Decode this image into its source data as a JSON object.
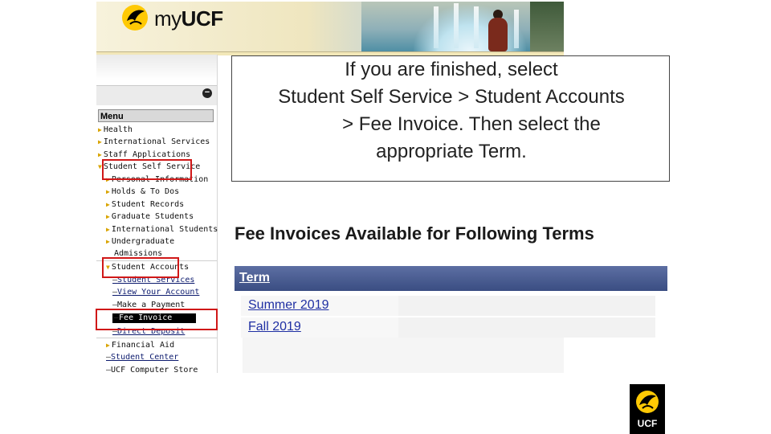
{
  "banner": {
    "logo_prefix": "my",
    "logo_name": "UCF"
  },
  "sidebar": {
    "collapse_symbol": "−",
    "menu_header": "Menu",
    "items": [
      {
        "label": "Health",
        "type": "folder"
      },
      {
        "label": "International Services",
        "type": "folder"
      },
      {
        "label": "Staff Applications",
        "type": "folder"
      },
      {
        "label": "Student Self Service",
        "type": "folder-open"
      },
      {
        "label": "Personal Information",
        "type": "subfolder"
      },
      {
        "label": "Holds & To Dos",
        "type": "subfolder"
      },
      {
        "label": "Student Records",
        "type": "subfolder"
      },
      {
        "label": "Graduate Students",
        "type": "subfolder"
      },
      {
        "label": "International Students",
        "type": "subfolder"
      },
      {
        "label": "Undergraduate",
        "type": "subfolder"
      },
      {
        "label": "Admissions",
        "type": "text"
      },
      {
        "label": "Student Accounts",
        "type": "subfolder-open"
      },
      {
        "label": "Student Services",
        "type": "link"
      },
      {
        "label": "View Your Account",
        "type": "link"
      },
      {
        "label": "Make a Payment",
        "type": "dash"
      },
      {
        "label": "Fee Invoice",
        "type": "selected"
      },
      {
        "label": "Direct Deposit",
        "type": "link"
      },
      {
        "label": "Financial Aid",
        "type": "subfolder"
      },
      {
        "label": "Student Center",
        "type": "link"
      },
      {
        "label": "UCF Computer Store",
        "type": "dash"
      }
    ]
  },
  "callout": {
    "lines": [
      "If you are finished, select",
      "Student Self Service > Student Accounts",
      "> Fee Invoice.  Then select the",
      "appropriate Term."
    ]
  },
  "main": {
    "title": "Fee Invoices Available for Following Terms",
    "term_header": "Term",
    "terms": [
      "Summer 2019",
      "Fall 2019"
    ]
  },
  "badge": {
    "text": "UCF"
  },
  "colors": {
    "highlight": "#d01818",
    "term_bar": "#4a5c90",
    "link": "#1f2fa3",
    "ucf_gold": "#ffc904"
  }
}
